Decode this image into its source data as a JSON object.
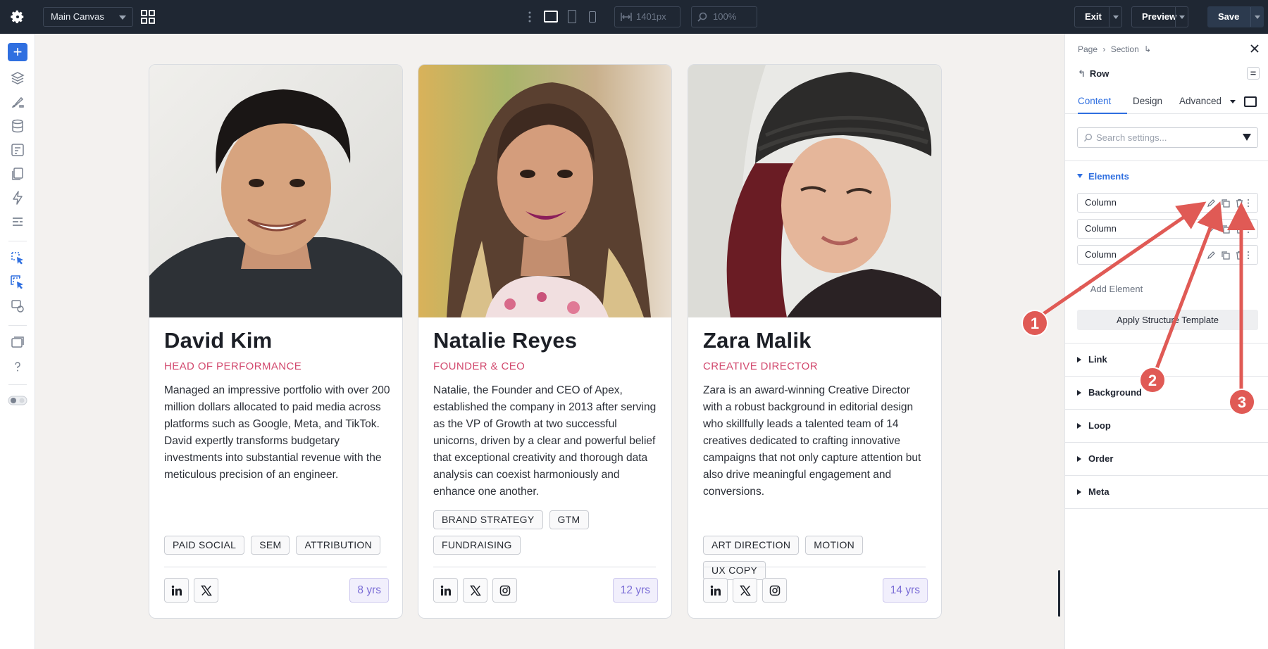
{
  "topbar": {
    "canvas_select": "Main Canvas",
    "width_field": "1401px",
    "zoom_field": "100%",
    "exit_label": "Exit",
    "preview_label": "Preview",
    "save_label": "Save"
  },
  "leftrail": {
    "icons": [
      "add-icon",
      "layers-icon",
      "brush-icon",
      "database-icon",
      "form-icon",
      "pages-icon",
      "bolt-icon",
      "list-icon",
      "cursor-select-icon",
      "cursor-multi-icon",
      "component-icon",
      "window-icon",
      "help-icon",
      "theme-toggle-icon"
    ]
  },
  "cards": [
    {
      "name": "David Kim",
      "role": "HEAD OF PERFORMANCE",
      "bio": "Managed an impressive portfolio with over 200 million dollars allocated to paid media across platforms such as Google, Meta, and TikTok. David expertly transforms budgetary investments into substantial revenue with the meticulous precision of an engineer.",
      "tags": [
        "PAID SOCIAL",
        "SEM",
        "ATTRIBUTION"
      ],
      "socials": [
        "linkedin-icon",
        "x-icon"
      ],
      "years": "8 yrs"
    },
    {
      "name": "Natalie Reyes",
      "role": "FOUNDER & CEO",
      "bio": "Natalie, the Founder and CEO of Apex, established the company in 2013 after serving as the VP of Growth at two successful unicorns, driven by a clear and powerful belief that exceptional creativity and thorough data analysis can coexist harmoniously and enhance one another.",
      "tags": [
        "BRAND STRATEGY",
        "GTM",
        "FUNDRAISING"
      ],
      "socials": [
        "linkedin-icon",
        "x-icon",
        "instagram-icon"
      ],
      "years": "12 yrs"
    },
    {
      "name": "Zara Malik",
      "role": "CREATIVE DIRECTOR",
      "bio": "Zara is an award-winning Creative Director with a robust background in editorial design who skillfully leads a talented team of 14 creatives dedicated to crafting innovative campaigns that not only capture attention but also drive meaningful engagement and conversions.",
      "tags": [
        "ART DIRECTION",
        "MOTION",
        "UX COPY"
      ],
      "socials": [
        "linkedin-icon",
        "x-icon",
        "instagram-icon"
      ],
      "years": "14 yrs"
    }
  ],
  "panel": {
    "breadcrumb": [
      "Page",
      "›",
      "Section",
      "↳"
    ],
    "title": "Row",
    "tabs": [
      "Content",
      "Design",
      "Advanced"
    ],
    "search_placeholder": "Search settings...",
    "elements_header": "Elements",
    "elements": [
      "Column",
      "Column",
      "Column"
    ],
    "add_element": "Add Element",
    "apply_template": "Apply Structure Template",
    "sections": [
      "Link",
      "Background",
      "Loop",
      "Order",
      "Meta"
    ]
  },
  "annotations": [
    "1",
    "2",
    "3"
  ],
  "colors": {
    "accent": "#2f6fe0",
    "role": "#d2496e",
    "badge": "#7b6dd6",
    "annotation": "#e05a55",
    "topbar": "#1f2733"
  }
}
